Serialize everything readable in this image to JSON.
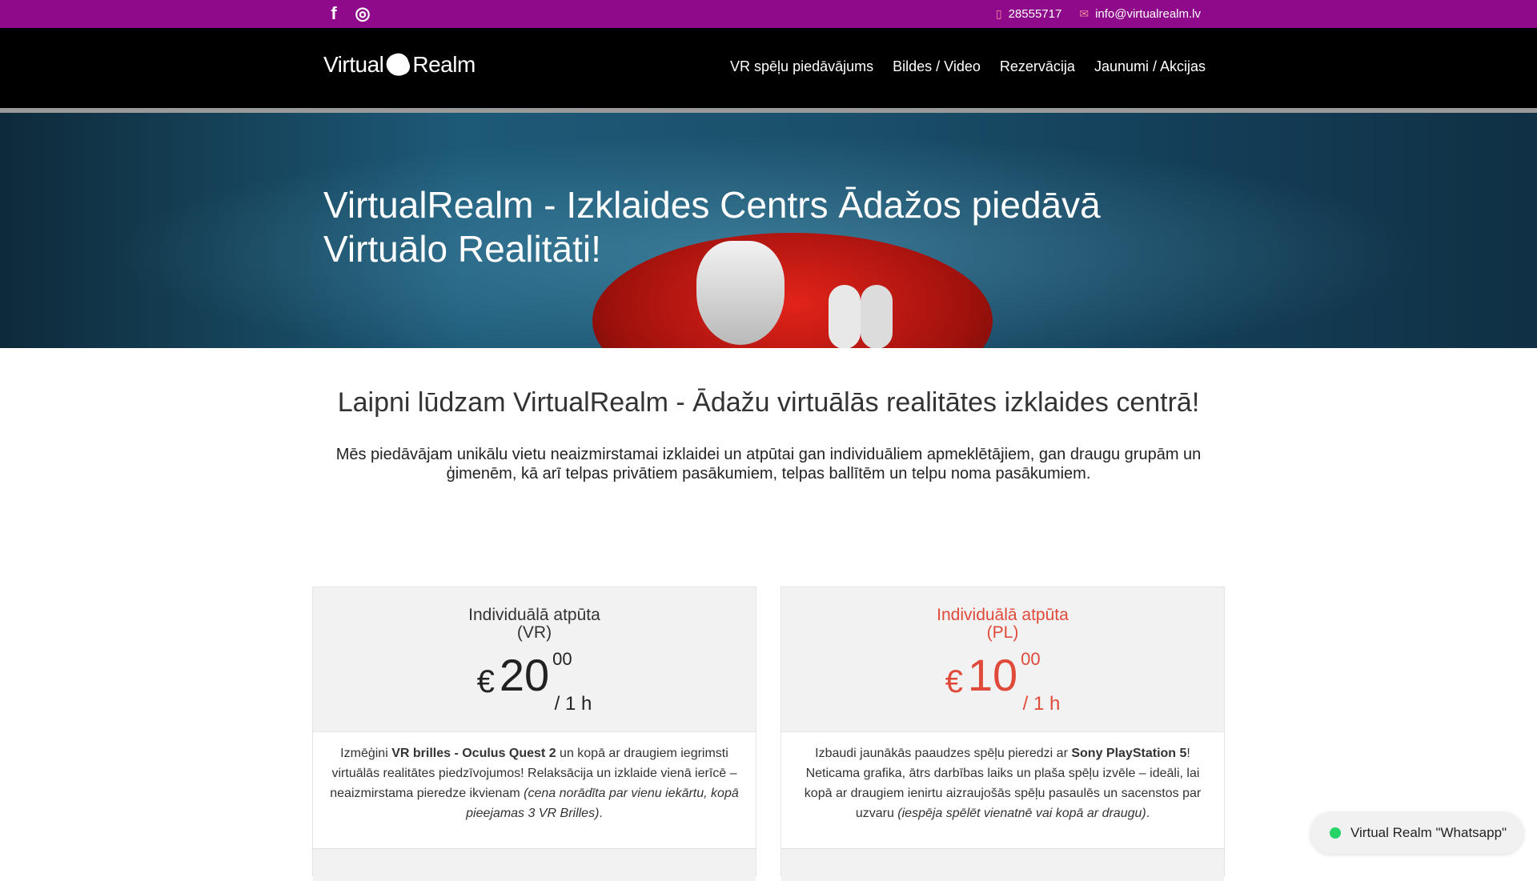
{
  "topbar": {
    "social": [
      {
        "icon": "facebook-icon",
        "glyph": "f"
      },
      {
        "icon": "instagram-icon",
        "glyph": "◎"
      }
    ],
    "phone": "28555717",
    "email": "info@virtualrealm.lv"
  },
  "header": {
    "logo_text_left": "Virtual",
    "logo_text_right": "Realm",
    "nav": [
      "VR spēļu piedāvājums",
      "Bildes / Video",
      "Rezervācija",
      "Jaunumi / Akcijas"
    ]
  },
  "hero": {
    "title": "VirtualRealm - Izklaides Centrs Ādažos piedāvā Virtuālo Realitāti!"
  },
  "welcome": {
    "heading": "Laipni lūdzam VirtualRealm - Ādažu virtuālās realitātes izklaides centrā!",
    "text": "Mēs piedāvājam unikālu vietu neaizmirstamai izklaidei un atpūtai gan individuāliem apmeklētājiem, gan draugu grupām un ģimenēm, kā arī telpas privātiem pasākumiem, telpas ballītēm un telpu noma pasākumiem."
  },
  "cards": [
    {
      "title_line1": "Individuālā atpūta",
      "title_line2": "(VR)",
      "currency": "€",
      "amount": "20",
      "cents": "00",
      "per": "/ 1 h",
      "body_pre": "Izmēģini ",
      "body_bold": "VR brilles - Oculus Quest 2",
      "body_mid": " un kopā ar draugiem iegrimsti virtuālās realitātes piedzīvojumos! Relaksācija un izklaide vienā ierīcē – neaizmirstama pieredze ikvienam ",
      "body_italic": "(cena norādīta par vienu iekārtu, kopā pieejamas 3 VR Brilles)",
      "body_post": "."
    },
    {
      "title_line1": "Individuālā atpūta",
      "title_line2": "(PL)",
      "currency": "€",
      "amount": "10",
      "cents": "00",
      "per": "/ 1 h",
      "body_pre": "Izbaudi jaunākās paaudzes spēļu pieredzi ar ",
      "body_bold": "Sony PlayStation 5",
      "body_mid": "! Neticama grafika, ātrs darbības laiks un plaša spēļu izvēle – ideāli, lai kopā ar draugiem ienirtu aizraujošās spēļu pasaulēs un sacenstos par uzvaru ",
      "body_italic": "(iespēja spēlēt vienatnē vai kopā ar draugu)",
      "body_post": "."
    }
  ],
  "whatsapp": {
    "label": "Virtual Realm \"Whatsapp\""
  },
  "colors": {
    "topbar": "#8e0a8a",
    "accent_red": "#e04a3a",
    "whatsapp_green": "#25d366"
  }
}
